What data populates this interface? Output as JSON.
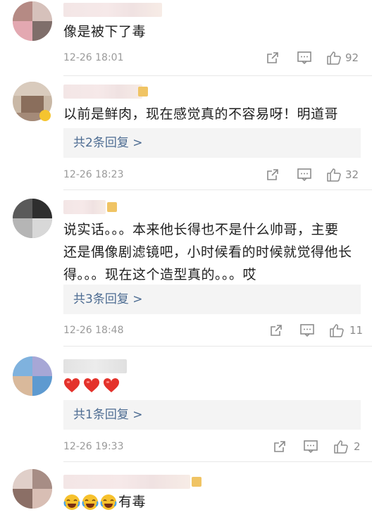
{
  "comments": [
    {
      "text": "像是被下了毒",
      "time": "12-26 18:01",
      "likes": "92",
      "replies_label": ""
    },
    {
      "text": "以前是鲜肉，现在感觉真的不容易呀！明道哥",
      "time": "12-26 18:23",
      "likes": "32",
      "replies_label": "共2条回复 >"
    },
    {
      "text_line1": "说实话。。。本来他长得也不是什么帅哥，主要",
      "text_line2": "还是偶像剧滤镜吧，小时候看的时候就觉得他长",
      "text_line3": "得。。。现在这个造型真的。。。哎",
      "time": "12-26 18:48",
      "likes": "11",
      "replies_label": "共3条回复 >"
    },
    {
      "emojis": [
        "heart",
        "heart",
        "heart"
      ],
      "time": "12-26 19:33",
      "likes": "2",
      "replies_label": "共1条回复 >"
    },
    {
      "emojis": [
        "laugh-cry",
        "laugh-cry",
        "laugh-cry"
      ],
      "text": "有毒"
    }
  ],
  "icons": {
    "share": "share-icon",
    "comment": "comment-icon",
    "like": "thumbs-up-icon"
  },
  "colors": {
    "reply_link": "#4d6c92",
    "meta_gray": "#9a9a9a",
    "heart_red": "#e4322b",
    "badge_gold": "#f0c464"
  }
}
